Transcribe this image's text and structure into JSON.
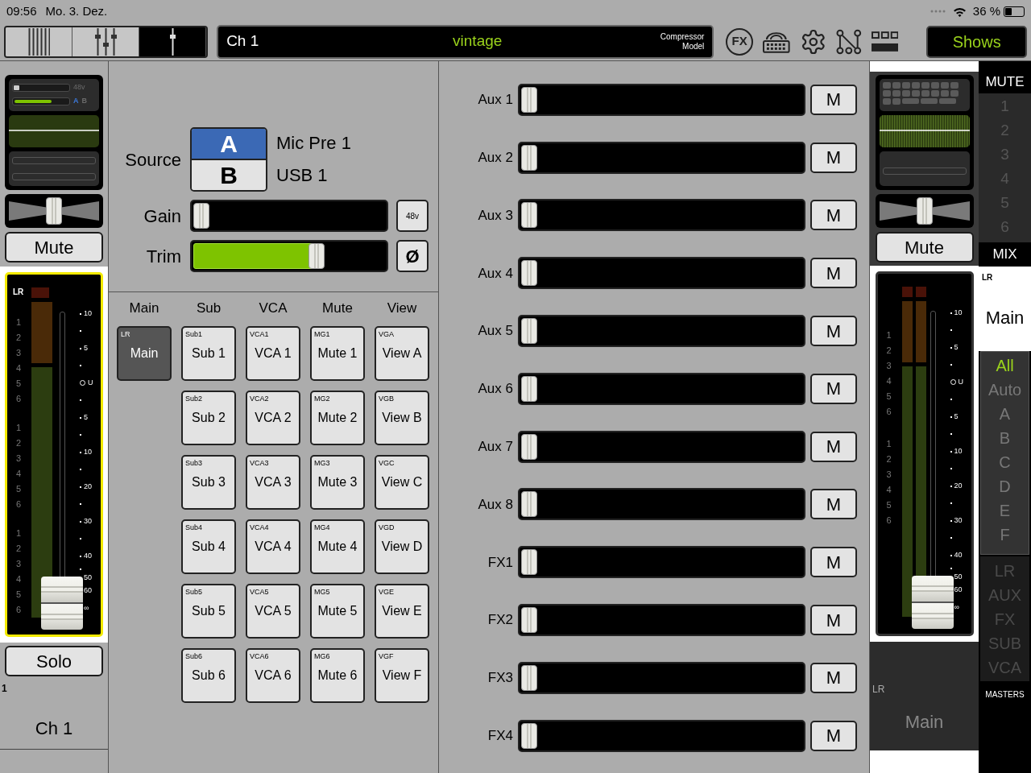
{
  "status_bar": {
    "time": "09:56",
    "date": "Mo. 3. Dez.",
    "battery": "36 %"
  },
  "toolbar": {
    "view_tabs": [
      {
        "selected": false
      },
      {
        "selected": false
      },
      {
        "selected": true
      }
    ],
    "channel_name": "Ch 1",
    "preset": "vintage",
    "model_label": "Compressor Model",
    "fx_label": "FX",
    "shows_button": "Shows"
  },
  "channel_strip": {
    "mini": {
      "phantom_label": "48v",
      "gain": {
        "level": 0.05
      },
      "trim": {
        "level": 0.7
      },
      "sources": [
        {
          "label": "A",
          "selected": true
        },
        {
          "label": "B",
          "selected": false
        }
      ]
    },
    "pan": {
      "level": 0.5
    },
    "mute": {
      "label": "Mute",
      "on": false
    },
    "meter": {
      "kind": "mono",
      "bus": "LR",
      "inputs": [
        "1",
        "2",
        "3",
        "4",
        "5",
        "6",
        "1",
        "2",
        "3",
        "4",
        "5",
        "6",
        "1",
        "2",
        "3",
        "4",
        "5",
        "6"
      ],
      "scale": [
        "10",
        "5",
        "U",
        "5",
        "10",
        "20",
        "30",
        "40",
        "50",
        "60",
        "∞"
      ],
      "level": 0.05,
      "selected": true
    },
    "solo": {
      "label": "Solo",
      "on": false
    },
    "number": "1",
    "name": "Ch 1"
  },
  "source_panel": {
    "source_label": "Source",
    "sources": [
      {
        "label": "A",
        "name": "Mic Pre 1",
        "selected": true
      },
      {
        "label": "B",
        "name": "USB 1",
        "selected": false
      }
    ],
    "gain": {
      "label": "Gain",
      "level": 0.0,
      "button": "48v",
      "on": false
    },
    "trim": {
      "label": "Trim",
      "level": 0.65,
      "button": "Ø",
      "on": false
    }
  },
  "assign": [
    {
      "header": "Main",
      "buttons": [
        {
          "tag": "LR",
          "label": "Main",
          "selected": true
        }
      ]
    },
    {
      "header": "Sub",
      "buttons": [
        {
          "tag": "Sub1",
          "label": "Sub 1",
          "selected": false
        },
        {
          "tag": "Sub2",
          "label": "Sub 2",
          "selected": false
        },
        {
          "tag": "Sub3",
          "label": "Sub 3",
          "selected": false
        },
        {
          "tag": "Sub4",
          "label": "Sub 4",
          "selected": false
        },
        {
          "tag": "Sub5",
          "label": "Sub 5",
          "selected": false
        },
        {
          "tag": "Sub6",
          "label": "Sub 6",
          "selected": false
        }
      ]
    },
    {
      "header": "VCA",
      "buttons": [
        {
          "tag": "VCA1",
          "label": "VCA 1",
          "selected": false
        },
        {
          "tag": "VCA2",
          "label": "VCA 2",
          "selected": false
        },
        {
          "tag": "VCA3",
          "label": "VCA 3",
          "selected": false
        },
        {
          "tag": "VCA4",
          "label": "VCA 4",
          "selected": false
        },
        {
          "tag": "VCA5",
          "label": "VCA 5",
          "selected": false
        },
        {
          "tag": "VCA6",
          "label": "VCA 6",
          "selected": false
        }
      ]
    },
    {
      "header": "Mute",
      "buttons": [
        {
          "tag": "MG1",
          "label": "Mute 1",
          "selected": false
        },
        {
          "tag": "MG2",
          "label": "Mute 2",
          "selected": false
        },
        {
          "tag": "MG3",
          "label": "Mute 3",
          "selected": false
        },
        {
          "tag": "MG4",
          "label": "Mute 4",
          "selected": false
        },
        {
          "tag": "MG5",
          "label": "Mute 5",
          "selected": false
        },
        {
          "tag": "MG6",
          "label": "Mute 6",
          "selected": false
        }
      ]
    },
    {
      "header": "View",
      "buttons": [
        {
          "tag": "VGA",
          "label": "View A",
          "selected": false
        },
        {
          "tag": "VGB",
          "label": "View B",
          "selected": false
        },
        {
          "tag": "VGC",
          "label": "View C",
          "selected": false
        },
        {
          "tag": "VGD",
          "label": "View D",
          "selected": false
        },
        {
          "tag": "VGE",
          "label": "View E",
          "selected": false
        },
        {
          "tag": "VGF",
          "label": "View F",
          "selected": false
        }
      ]
    }
  ],
  "sends": [
    {
      "label": "Aux 1",
      "level": 0.0,
      "mute": "M",
      "on": false
    },
    {
      "label": "Aux 2",
      "level": 0.0,
      "mute": "M",
      "on": false
    },
    {
      "label": "Aux 3",
      "level": 0.0,
      "mute": "M",
      "on": false
    },
    {
      "label": "Aux 4",
      "level": 0.0,
      "mute": "M",
      "on": false
    },
    {
      "label": "Aux 5",
      "level": 0.0,
      "mute": "M",
      "on": false
    },
    {
      "label": "Aux 6",
      "level": 0.0,
      "mute": "M",
      "on": false
    },
    {
      "label": "Aux 7",
      "level": 0.0,
      "mute": "M",
      "on": false
    },
    {
      "label": "Aux 8",
      "level": 0.0,
      "mute": "M",
      "on": false
    },
    {
      "label": "FX1",
      "level": 0.0,
      "mute": "M",
      "on": false
    },
    {
      "label": "FX2",
      "level": 0.0,
      "mute": "M",
      "on": false
    },
    {
      "label": "FX3",
      "level": 0.0,
      "mute": "M",
      "on": false
    },
    {
      "label": "FX4",
      "level": 0.0,
      "mute": "M",
      "on": false
    }
  ],
  "master_strip": {
    "pan": {
      "level": 0.5
    },
    "mute": {
      "label": "Mute",
      "on": false
    },
    "meter": {
      "kind": "stereo",
      "inputs": [
        "1",
        "2",
        "3",
        "4",
        "5",
        "6",
        "1",
        "2",
        "3",
        "4",
        "5",
        "6"
      ],
      "scale": [
        "10",
        "5",
        "U",
        "5",
        "10",
        "20",
        "30",
        "40",
        "50",
        "60",
        "∞"
      ],
      "level": 0.05,
      "selected": false
    },
    "bus": "LR",
    "name": "Main"
  },
  "sidebar": {
    "mute_header": "MUTE",
    "mute_groups": [
      "1",
      "2",
      "3",
      "4",
      "5",
      "6"
    ],
    "mix_header": "MIX",
    "bus": "LR",
    "name": "Main",
    "filters": [
      {
        "label": "All",
        "selected": true
      },
      {
        "label": "Auto",
        "selected": false
      },
      {
        "label": "A",
        "selected": false
      },
      {
        "label": "B",
        "selected": false
      },
      {
        "label": "C",
        "selected": false
      },
      {
        "label": "D",
        "selected": false
      },
      {
        "label": "E",
        "selected": false
      },
      {
        "label": "F",
        "selected": false
      }
    ],
    "masters": [
      {
        "label": "LR",
        "selected": false
      },
      {
        "label": "AUX",
        "selected": false
      },
      {
        "label": "FX",
        "selected": false
      },
      {
        "label": "SUB",
        "selected": false
      },
      {
        "label": "VCA",
        "selected": false
      }
    ],
    "masters_label": "MASTERS"
  }
}
